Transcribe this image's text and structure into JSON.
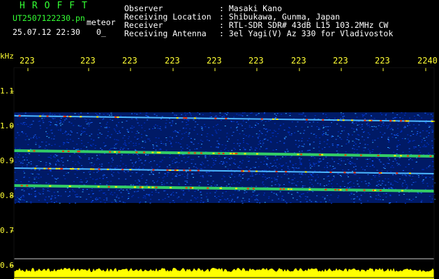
{
  "header": {
    "brand": "HROFFT",
    "filename": "UT2507122230.pn",
    "mode": "meteor",
    "datetime": "25.07.12 22:30",
    "count": "0_",
    "labels": [
      "Observer",
      "Receiving Location",
      "Receiver",
      "Receiving Antenna"
    ],
    "values": [
      ": Masaki Kano",
      ": Shibukawa, Gunma, Japan",
      ": RTL-SDR SDR# 43dB L15 103.2MHz CW",
      ": 3el Yagi(V) Az 330 for Vladivostok"
    ]
  },
  "colors": {
    "brand": "#33ff33",
    "label": "#ffffff",
    "axis": "#ffff33",
    "background": "#000000"
  },
  "chart_data": {
    "type": "heatmap",
    "ylabel": "kHz",
    "y_ticks": [
      "1.1",
      "1.0",
      "0.9",
      "0.8",
      "0.7",
      "0.6"
    ],
    "ylim": [
      0.6,
      1.15
    ],
    "x_ticks": [
      "223",
      "223",
      "223",
      "223",
      "223",
      "223",
      "223",
      "223",
      "223",
      "2240"
    ],
    "bands_khz": [
      1.03,
      0.93,
      0.88,
      0.83
    ],
    "band_top_khz": 1.04,
    "band_bottom_khz": 0.78
  }
}
